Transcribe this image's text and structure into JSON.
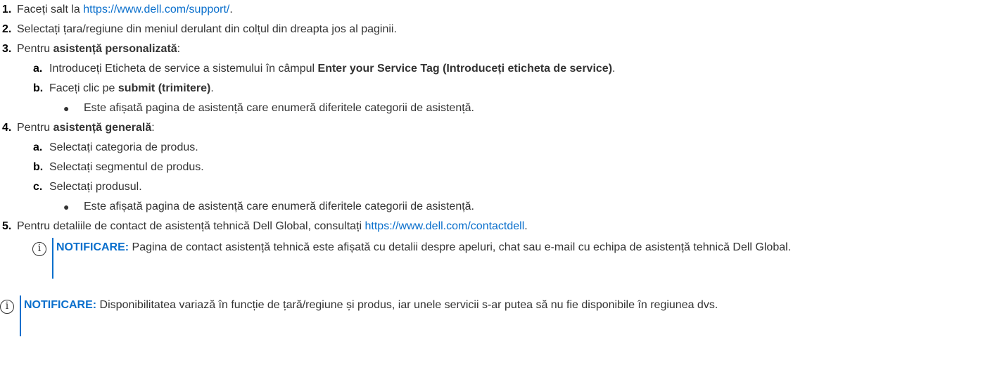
{
  "steps": [
    {
      "number": "1.",
      "text_before": "Faceți salt la ",
      "link": "https://www.dell.com/support/",
      "text_after": "."
    },
    {
      "number": "2.",
      "text": "Selectați țara/regiune din meniul derulant din colțul din dreapta jos al paginii."
    },
    {
      "number": "3.",
      "text_before": "Pentru ",
      "bold": "asistență personalizată",
      "text_after": ":",
      "substeps": [
        {
          "letter": "a.",
          "text_before": "Introduceți Eticheta de service a sistemului în câmpul ",
          "bold": "Enter your Service Tag (Introduceți eticheta de service)",
          "text_after": "."
        },
        {
          "letter": "b.",
          "text_before": "Faceți clic pe ",
          "bold": "submit (trimitere)",
          "text_after": ".",
          "bullet": "Este afișată pagina de asistență care enumeră diferitele categorii de asistență."
        }
      ]
    },
    {
      "number": "4.",
      "text_before": "Pentru ",
      "bold": "asistență generală",
      "text_after": ":",
      "substeps": [
        {
          "letter": "a.",
          "text": "Selectați categoria de produs."
        },
        {
          "letter": "b.",
          "text": "Selectați segmentul de produs."
        },
        {
          "letter": "c.",
          "text": "Selectați produsul.",
          "bullet": "Este afișată pagina de asistență care enumeră diferitele categorii de asistență."
        }
      ]
    },
    {
      "number": "5.",
      "text_before": "Pentru detaliile de contact de asistență tehnică Dell Global, consultați ",
      "link": "https://www.dell.com/contactdell",
      "text_after": "."
    }
  ],
  "notes": [
    {
      "label": "NOTIFICARE:",
      "text": " Pagina de contact asistență tehnică este afișată cu detalii despre apeluri, chat sau e-mail cu echipa de asistență tehnică Dell Global."
    },
    {
      "label": "NOTIFICARE:",
      "text": " Disponibilitatea variază în funcție de țară/regiune și produs, iar unele servicii s-ar putea să nu fie disponibile în regiunea dvs."
    }
  ],
  "icons": {
    "note": "info-circle-icon",
    "bullet": "bullet-dot-icon"
  },
  "colors": {
    "link": "#0a6fcc",
    "note_label": "#0a6fcc",
    "note_bar": "#0a6fcc",
    "text": "#333333"
  }
}
